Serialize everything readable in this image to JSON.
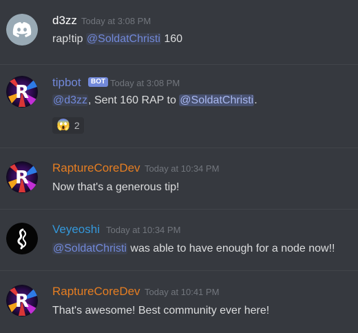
{
  "messages": [
    {
      "author": "d3zz",
      "timestamp": "Today at 3:08 PM",
      "text_before": "rap!tip ",
      "mention": "@SoldatChristi",
      "text_after": " 160",
      "avatar_icon": "discord-logo-icon"
    },
    {
      "author": "tipbot",
      "bot_tag": "BOT",
      "timestamp": "Today at 3:08 PM",
      "mention1": "@d3zz",
      "text_mid": ", Sent 160 RAP to ",
      "mention2": "@SoldatChristi",
      "text_after": ".",
      "avatar_icon": "rapture-logo-icon",
      "reaction": {
        "emoji": "😱",
        "emoji_icon": "scream-emoji-icon",
        "count": "2"
      }
    },
    {
      "author": "RaptureCoreDev",
      "timestamp": "Today at 10:34 PM",
      "text": "Now that's a generous tip!",
      "avatar_icon": "rapture-logo-icon"
    },
    {
      "author": "Veyeoshi",
      "timestamp": "Today at 10:34 PM",
      "mention": "@SoldatChristi",
      "text_after": " was able to have enough for a node now!!",
      "avatar_icon": "spiral-logo-icon"
    },
    {
      "author": "RaptureCoreDev",
      "timestamp": "Today at 10:41 PM",
      "text": "That's awesome! Best community ever here!",
      "avatar_icon": "rapture-logo-icon"
    }
  ],
  "colors": {
    "background": "#36393f",
    "text": "#dcddde",
    "timestamp": "#72767d",
    "mention": "#7289da",
    "author_default": "#ffffff",
    "author_tipbot": "#7289da",
    "author_rapturecoredev": "#e67e22",
    "author_veyeoshi": "#3498db",
    "bot_tag": "#7289da"
  }
}
